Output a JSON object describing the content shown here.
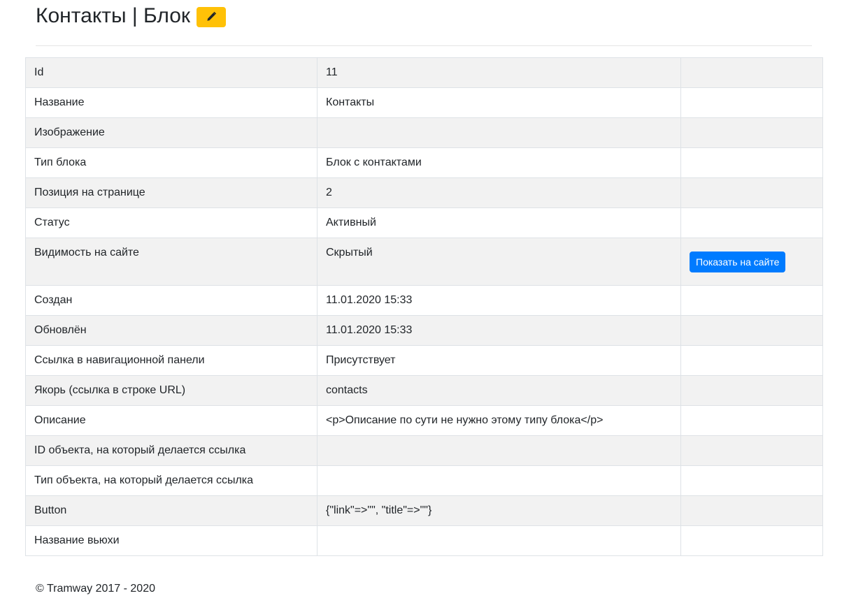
{
  "header": {
    "title": "Контакты | Блок",
    "edit_icon": "pencil-icon",
    "edit_button_color": "#ffc107"
  },
  "table": {
    "rows": [
      {
        "label": "Id",
        "value": "11"
      },
      {
        "label": "Название",
        "value": "Контакты"
      },
      {
        "label": "Изображение",
        "value": ""
      },
      {
        "label": "Тип блока",
        "value": "Блок с контактами"
      },
      {
        "label": "Позиция на странице",
        "value": "2"
      },
      {
        "label": "Статус",
        "value": "Активный"
      },
      {
        "label": "Видимость на сайте",
        "value": "Скрытый",
        "action": "Показать на сайте"
      },
      {
        "label": "Создан",
        "value": "11.01.2020 15:33"
      },
      {
        "label": "Обновлён",
        "value": "11.01.2020 15:33"
      },
      {
        "label": "Ссылка в навигационной панели",
        "value": "Присутствует"
      },
      {
        "label": "Якорь (ссылка в строке URL)",
        "value": "contacts"
      },
      {
        "label": "Описание",
        "value": "<p>Описание по сути не нужно этому типу блока</p>"
      },
      {
        "label": "ID объекта, на который делается ссылка",
        "value": ""
      },
      {
        "label": "Тип объекта, на который делается ссылка",
        "value": ""
      },
      {
        "label": "Button",
        "value": "{\"link\"=>\"\", \"title\"=>\"\"}"
      },
      {
        "label": "Название вьюхи",
        "value": ""
      }
    ],
    "action_button_color": "#007bff"
  },
  "footer": {
    "copyright": "© Tramway 2017 - 2020"
  }
}
